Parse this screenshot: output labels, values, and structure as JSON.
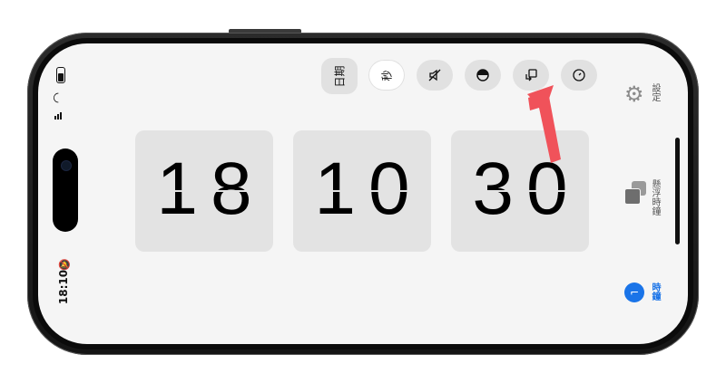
{
  "status_bar": {
    "time": "18:10"
  },
  "controls": {
    "date_label": "日期",
    "seconds_label": "秒"
  },
  "clock": {
    "hours": "18",
    "minutes": "10",
    "seconds": "30"
  },
  "sidebar": {
    "settings_label": "設定",
    "floating_clock_label": "懸浮時鐘",
    "clock_label": "時鐘"
  },
  "colors": {
    "accent_blue": "#1a74e8",
    "annotation_arrow": "#f0525a"
  },
  "icons": [
    "gear-icon",
    "seconds-icon",
    "mute-icon",
    "contrast-icon",
    "rotate-icon",
    "timer-icon",
    "floating-window-icon",
    "clock-app-icon"
  ]
}
